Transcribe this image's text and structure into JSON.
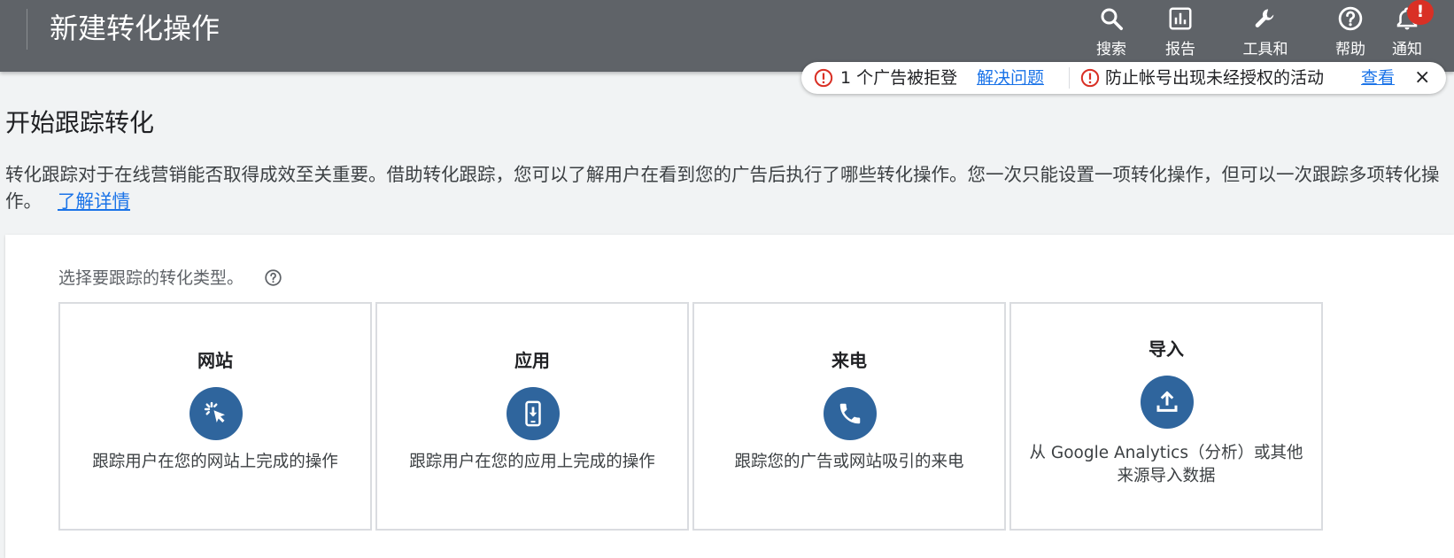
{
  "header": {
    "title": "新建转化操作",
    "nav": [
      {
        "label": "搜索",
        "icon": "search-icon"
      },
      {
        "label": "报告",
        "icon": "bar-chart-icon"
      },
      {
        "label": "工具和",
        "icon": "wrench-icon"
      },
      {
        "label": "帮助",
        "icon": "help-icon"
      },
      {
        "label": "通知",
        "icon": "bell-icon"
      }
    ],
    "notification_badge": "!"
  },
  "alerts": {
    "first_text": "1 个广告被拒登",
    "first_link": "解决问题",
    "second_text": "防止帐号出现未经授权的活动",
    "second_link": "查看",
    "close_label": "×"
  },
  "main": {
    "title": "开始跟踪转化",
    "description": "转化跟踪对于在线营销能否取得成效至关重要。借助转化跟踪，您可以了解用户在看到您的广告后执行了哪些转化操作。您一次只能设置一项转化操作，但可以一次跟踪多项转化操作。",
    "learn_more": "了解详情",
    "prompt": "选择要跟踪的转化类型。",
    "cards": [
      {
        "title": "网站",
        "description": "跟踪用户在您的网站上完成的操作",
        "icon": "cursor-click-icon"
      },
      {
        "title": "应用",
        "description": "跟踪用户在您的应用上完成的操作",
        "icon": "phone-download-icon"
      },
      {
        "title": "来电",
        "description": "跟踪您的广告或网站吸引的来电",
        "icon": "phone-call-icon"
      },
      {
        "title": "导入",
        "description_line1": "从 Google Analytics（分析）或其他",
        "description_line2": "来源导入数据",
        "icon": "upload-icon"
      }
    ]
  },
  "colors": {
    "topbar": "#5f6368",
    "accent": "#2f659d",
    "link": "#1a73e8",
    "error": "#d93025"
  }
}
